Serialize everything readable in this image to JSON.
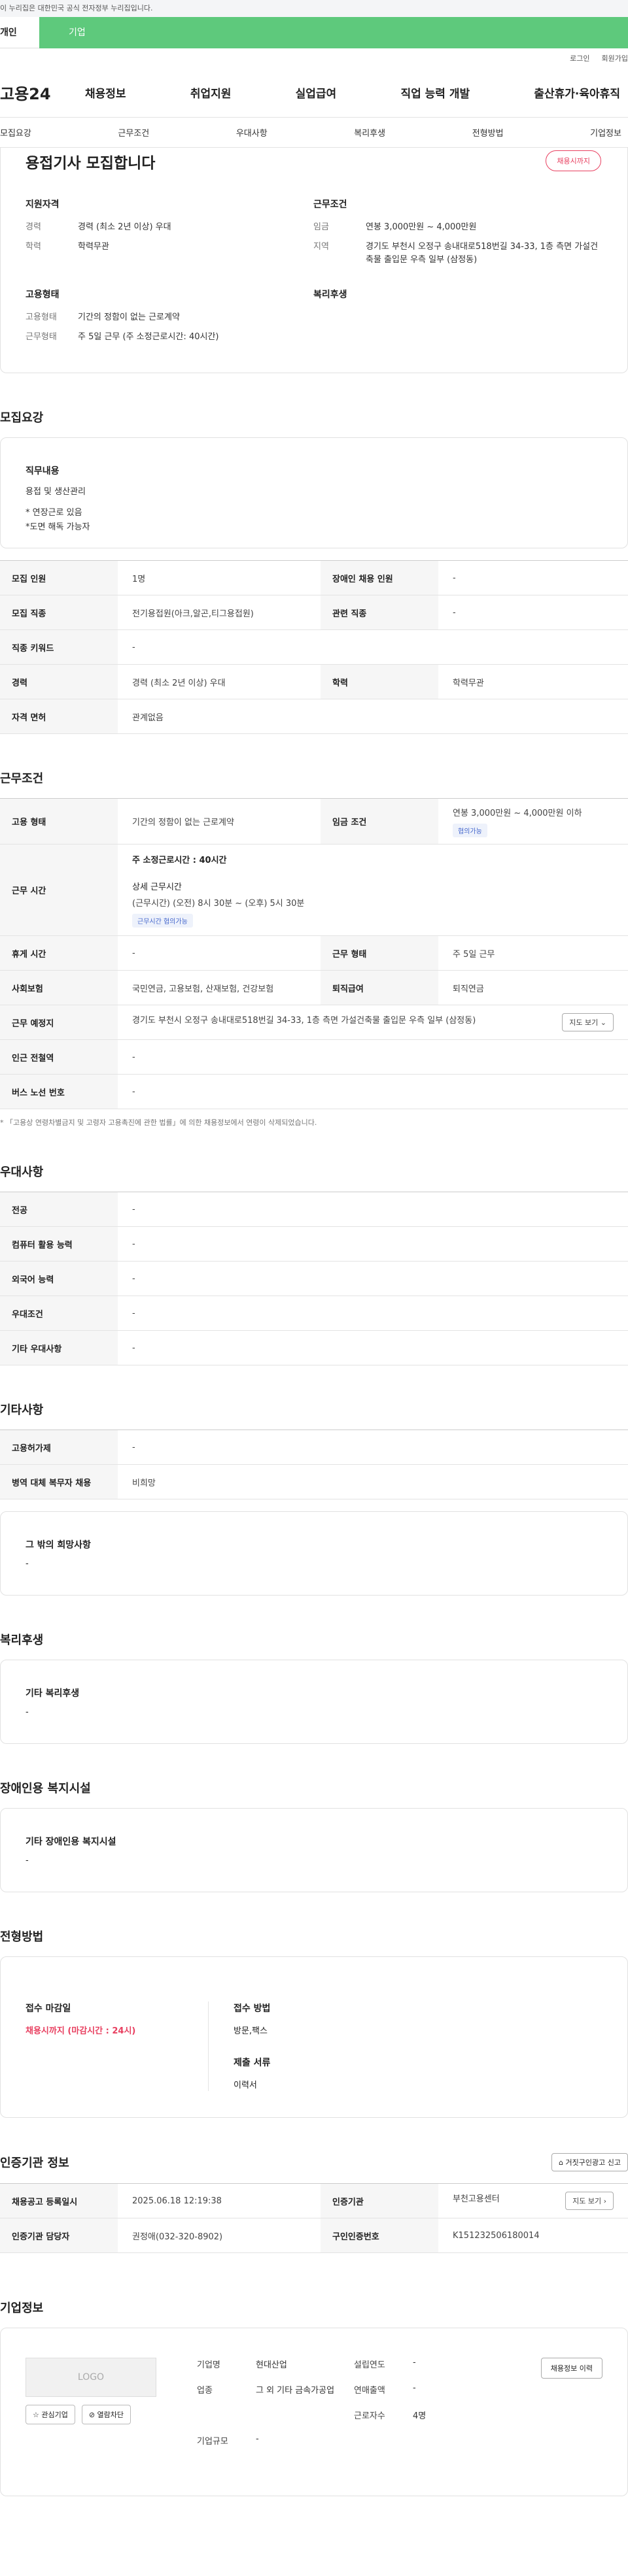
{
  "gov_notice": "이 누리집은 대한민국 공식 전자정부 누리집입니다.",
  "top_tabs": [
    "개인",
    "기업"
  ],
  "util": [
    "로그인",
    "회원가입"
  ],
  "logo": "고용24",
  "gnb": [
    "채용정보",
    "취업지원",
    "실업급여",
    "직업 능력 개발",
    "출산휴가·육아휴직"
  ],
  "subtabs": [
    "모집요강",
    "근무조건",
    "우대사항",
    "복리후생",
    "전형방법",
    "기업정보"
  ],
  "summary": {
    "title": "용접기사 모집합니다",
    "status_pill": "채용시까지",
    "qual_heading": "지원자격",
    "work_heading": "근무조건",
    "career_label": "경력",
    "career": "경력 (최소 2년 이상) 우대",
    "edu_label": "학력",
    "edu": "학력무관",
    "wage_label": "임금",
    "wage": "연봉 3,000만원 ~ 4,000만원",
    "area_label": "지역",
    "area": "경기도 부천시 오정구 송내대로518번길 34-33, 1층 측면 가설건축물 출입문 우측 일부 (삼정동)",
    "emp_heading": "고용형태",
    "welfare_heading": "복리후생",
    "emp_label": "고용형태",
    "emp": "기간의 정함이 없는 근로계약",
    "emp2_label": "근무형태",
    "emp2": "주 5일 근무 (주 소정근로시간: 40시간)"
  },
  "recruit": {
    "title": "모집요강",
    "duty_heading": "직무내용",
    "duty_lines": [
      "용접 및 생산관리",
      "",
      "* 연장근로 있음",
      "*도면 해독 가능자"
    ],
    "rows": {
      "count_label": "모집 인원",
      "count": "1명",
      "disabled_label": "장애인 채용 인원",
      "disabled": "-",
      "job_label": "모집 직종",
      "job": "전기용접원(아크,알곤,티그용접원)",
      "related_label": "관련 직종",
      "related": "-",
      "keyword_label": "직종 키워드",
      "keyword": "-",
      "career_label": "경력",
      "career": "경력 (최소 2년 이상) 우대",
      "edu_label": "학력",
      "edu": "학력무관",
      "license_label": "자격 면허",
      "license": "관계없음"
    }
  },
  "work": {
    "title": "근무조건",
    "type_label": "고용 형태",
    "type": "기간의 정함이 없는 근로계약",
    "wage_label": "임금 조건",
    "wage": "연봉 3,000만원 ~ 4,000만원 이하",
    "wage_tag": "협의가능",
    "hours_label": "근무 시간",
    "hours_main": "주 소정근로시간 : 40시간",
    "hours_detail_h": "상세 근무시간",
    "hours_detail": "(근무시간) (오전) 8시 30분 ~ (오후) 5시 30분",
    "hours_tag": "근무시간 협의가능",
    "rest_label": "휴게 시간",
    "rest": "-",
    "form_label": "근무 형태",
    "form": "주 5일 근무",
    "insurance_label": "사회보험",
    "insurance": "국민연금, 고용보험, 산재보험, 건강보험",
    "severance_label": "퇴직급여",
    "severance": "퇴직연금",
    "place_label": "근무 예정지",
    "place": "경기도 부천시 오정구 송내대로518번길 34-33, 1층 측면 가설건축물 출입문 우측 일부 (삼정동)",
    "map_btn": "지도 보기 ⌄",
    "station_label": "인근 전철역",
    "station": "-",
    "bus_label": "버스 노선 번호",
    "bus": "-",
    "note": "* 「고용상 연령차별금지 및 고령자 고용촉진에 관한 법률」에 의한 채용정보에서 연령이 삭제되었습니다."
  },
  "pref": {
    "title": "우대사항",
    "rows": [
      [
        "전공",
        "-"
      ],
      [
        "컴퓨터 활용 능력",
        "-"
      ],
      [
        "외국어 능력",
        "-"
      ],
      [
        "우대조건",
        "-"
      ],
      [
        "기타 우대사항",
        "-"
      ]
    ]
  },
  "etc": {
    "title": "기타사항",
    "rows": [
      [
        "고용허가제",
        "-"
      ],
      [
        "병역 대체 복무자 채용",
        "비희망"
      ]
    ],
    "box_h": "그 밖의 희망사항",
    "box_v": "-"
  },
  "welfare": {
    "title": "복리후생",
    "h": "기타 복리후생",
    "v": "-"
  },
  "disabled": {
    "title": "장애인용 복지시설",
    "h": "기타 장애인용 복지시설",
    "v": "-"
  },
  "apply": {
    "title": "전형방법",
    "deadline_h": "접수 마감일",
    "deadline": "채용시까지 (마감시간 : 24시)",
    "method_h": "접수 방법",
    "method": "방문,팩스",
    "docs_h": "제출 서류",
    "docs": "이력서"
  },
  "agency": {
    "title": "인증기관 정보",
    "report_btn": "⌂ 거짓구인광고 신고",
    "reg_label": "채용공고 등록일시",
    "reg": "2025.06.18 12:19:38",
    "inst_label": "인증기관",
    "inst": "부천고용센터",
    "map_btn": "지도 보기 ›",
    "manager_label": "인증기관 담당자",
    "manager": "권정애(032-320-8902)",
    "num_label": "구인인증번호",
    "num": "K151232506180014"
  },
  "company": {
    "title": "기업정보",
    "logo": "LOGO",
    "btn1": "☆ 관심기업",
    "btn2": "⊘ 열람차단",
    "history_btn": "채용정보 이력",
    "name_label": "기업명",
    "name": "현대산업",
    "year_label": "설립연도",
    "year": "-",
    "ind_label": "업종",
    "ind": "그 외 기타 금속가공업",
    "sales_label": "연매출액",
    "sales": "-",
    "emp_label": "근로자수",
    "emp": "4명",
    "scale_label": "기업규모",
    "scale": "-"
  }
}
